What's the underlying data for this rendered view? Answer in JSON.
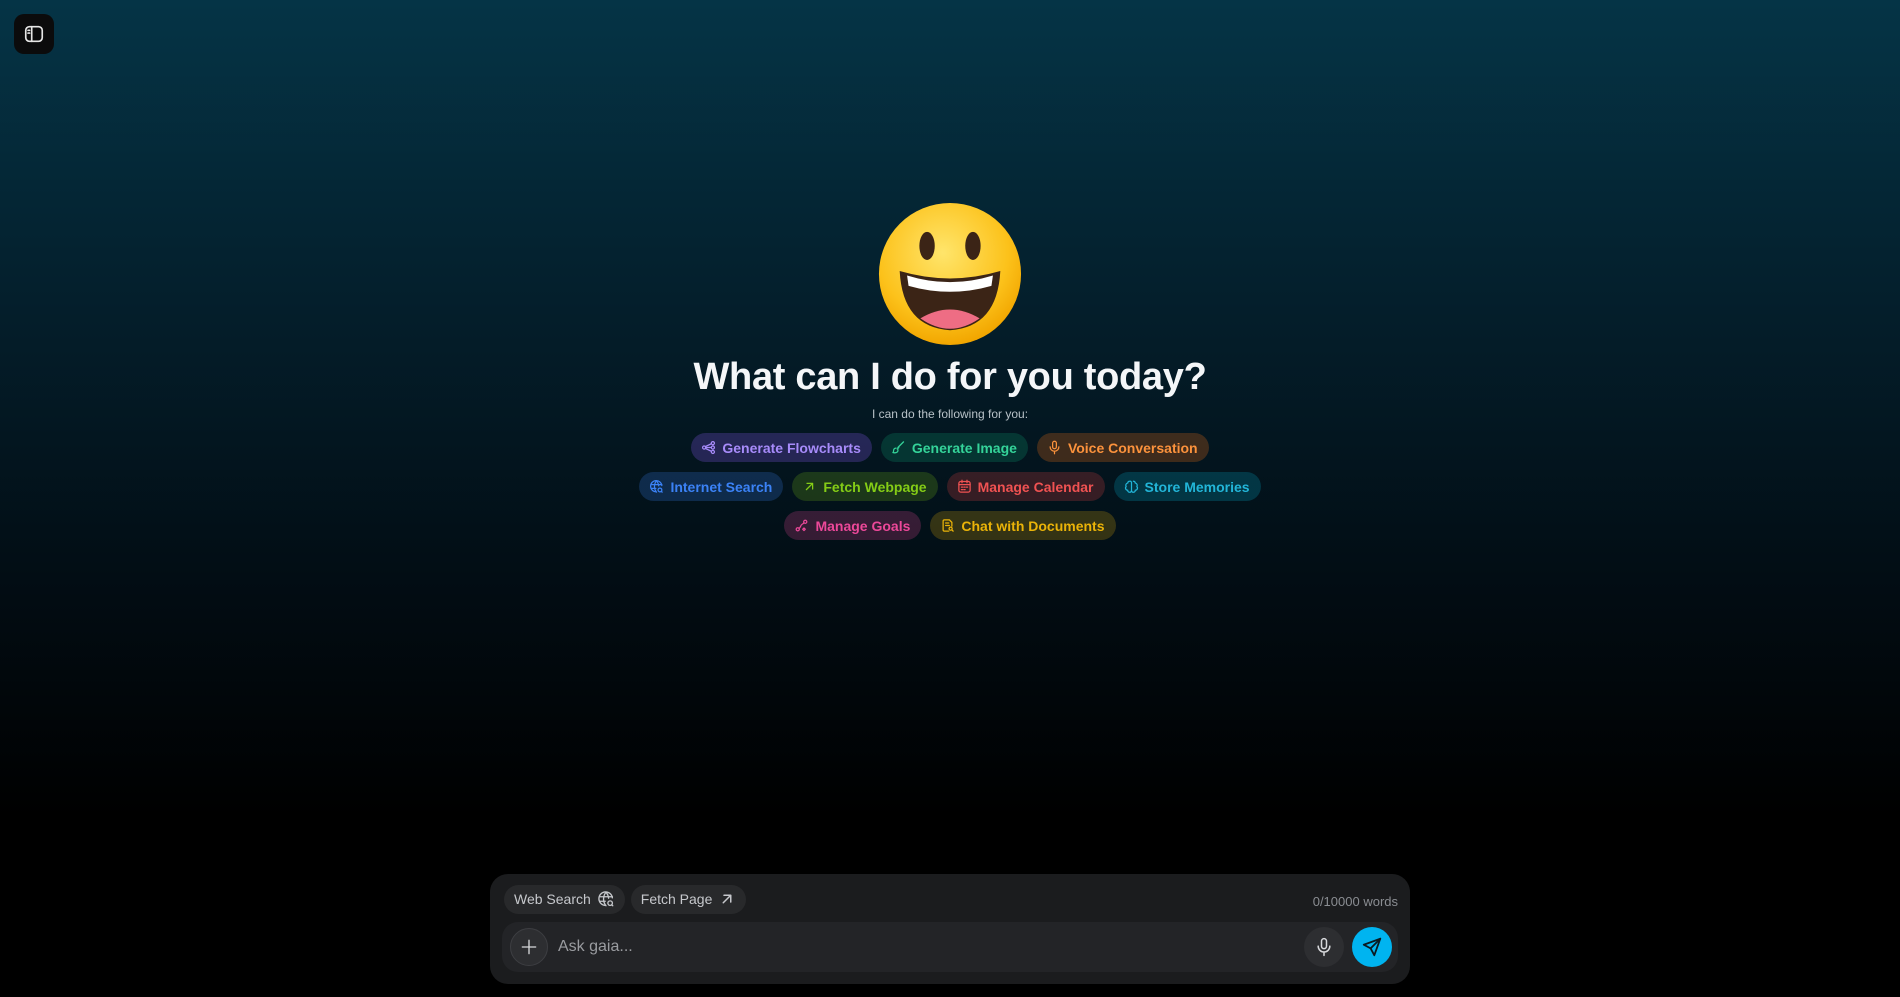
{
  "sidebar_toggle": {
    "icon": "sidebar-panel-icon"
  },
  "hero": {
    "emoji": "grinning-face-emoji",
    "title": "What can I do for you today?",
    "subtitle": "I can do the following for you:"
  },
  "features": {
    "row1": [
      {
        "label": "Generate Flowcharts",
        "icon": "flowchart-icon",
        "color": "#a78bfa"
      },
      {
        "label": "Generate Image",
        "icon": "paintbrush-icon",
        "color": "#34d399"
      },
      {
        "label": "Voice Conversation",
        "icon": "microphone-icon",
        "color": "#fb923c"
      }
    ],
    "row2": [
      {
        "label": "Internet Search",
        "icon": "globe-search-icon",
        "color": "#3b82f6"
      },
      {
        "label": "Fetch Webpage",
        "icon": "arrow-up-right-icon",
        "color": "#84cc16"
      },
      {
        "label": "Manage Calendar",
        "icon": "calendar-icon",
        "color": "#f05252"
      },
      {
        "label": "Store Memories",
        "icon": "brain-icon",
        "color": "#22b5d8"
      }
    ],
    "row3": [
      {
        "label": "Manage Goals",
        "icon": "goal-icon",
        "color": "#ec4899"
      },
      {
        "label": "Chat with Documents",
        "icon": "document-search-icon",
        "color": "#eab308"
      }
    ]
  },
  "composer": {
    "web_search_label": "Web Search",
    "fetch_page_label": "Fetch Page",
    "word_count": "0/10000 words",
    "placeholder": "Ask gaia...",
    "send_color": "#00b4f0"
  }
}
